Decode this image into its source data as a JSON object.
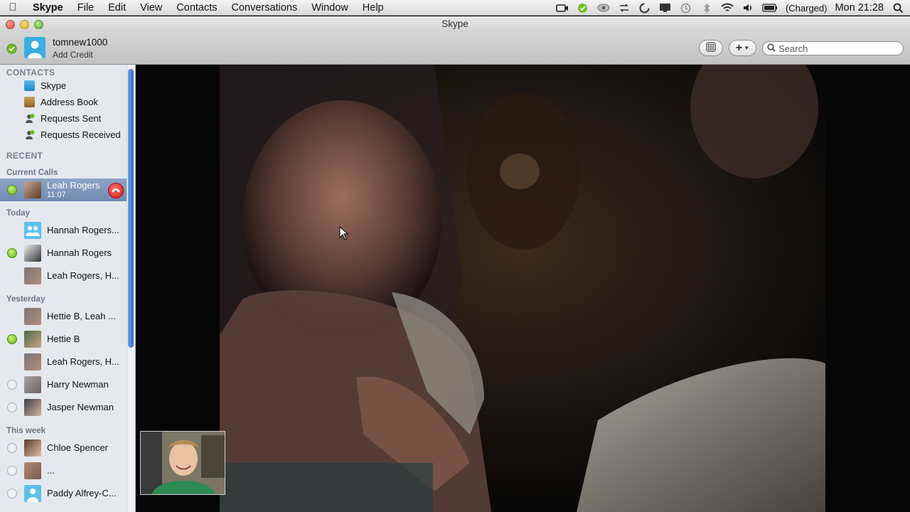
{
  "menubar": {
    "app_name": "Skype",
    "menus": [
      "File",
      "Edit",
      "View",
      "Contacts",
      "Conversations",
      "Window",
      "Help"
    ],
    "battery_status": "(Charged)",
    "clock": "Mon 21:28",
    "status_icons": [
      "camera-icon",
      "skype-status-icon",
      "eye-icon",
      "sync-icon",
      "spinner-icon",
      "screen-icon",
      "time-machine-icon",
      "bluetooth-icon",
      "wifi-icon",
      "volume-icon",
      "battery-icon",
      "spotlight-icon"
    ]
  },
  "window": {
    "title": "Skype"
  },
  "toolbar": {
    "username": "tomnew1000",
    "credit_link": "Add Credit",
    "search_placeholder": "Search"
  },
  "sidebar": {
    "contacts_heading": "CONTACTS",
    "contacts_items": [
      {
        "label": "Skype",
        "icon": "skype-book-icon"
      },
      {
        "label": "Address Book",
        "icon": "address-book-icon"
      },
      {
        "label": "Requests Sent",
        "icon": "request-sent-icon"
      },
      {
        "label": "Requests Received",
        "icon": "request-received-icon"
      }
    ],
    "recent_heading": "RECENT",
    "current_calls_heading": "Current Calls",
    "current_call": {
      "name": "Leah Rogers",
      "duration": "11:07",
      "status": "online"
    },
    "today_heading": "Today",
    "today": [
      {
        "name": "Hannah Rogers...",
        "status": "none",
        "avatar": "group"
      },
      {
        "name": "Hannah Rogers",
        "status": "online",
        "avatar": "photo"
      },
      {
        "name": "Leah Rogers, H...",
        "status": "none",
        "avatar": "photo"
      }
    ],
    "yesterday_heading": "Yesterday",
    "yesterday": [
      {
        "name": "Hettie B, Leah ...",
        "status": "none",
        "avatar": "photo"
      },
      {
        "name": "Hettie B",
        "status": "online",
        "avatar": "photo"
      },
      {
        "name": "Leah Rogers, H...",
        "status": "none",
        "avatar": "photo"
      },
      {
        "name": "Harry Newman",
        "status": "offline",
        "avatar": "photo"
      },
      {
        "name": "Jasper Newman",
        "status": "offline",
        "avatar": "photo"
      }
    ],
    "this_week_heading": "This week",
    "this_week": [
      {
        "name": "Chloe Spencer",
        "status": "offline",
        "avatar": "photo"
      },
      {
        "name": "...",
        "status": "offline",
        "avatar": "photo"
      },
      {
        "name": "Paddy Alfrey-C...",
        "status": "offline",
        "avatar": "default"
      }
    ]
  },
  "colors": {
    "online": "#5eae15",
    "selected_row": "#7f97bd",
    "sidebar_bg": "#e5e9ef",
    "hangup": "#d41616",
    "skype_blue": "#3aaee3"
  }
}
